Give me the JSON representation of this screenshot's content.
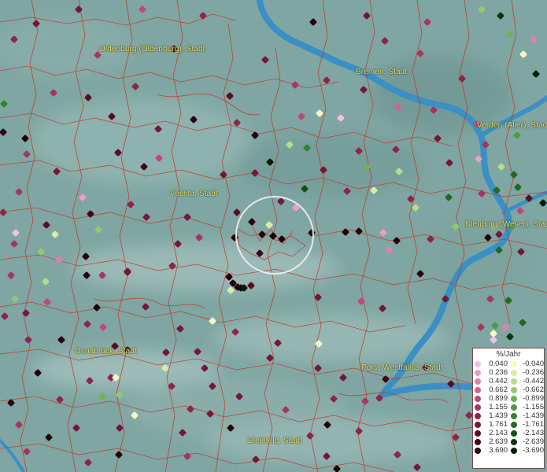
{
  "map": {
    "unit": "%/Jahr",
    "colors": {
      "background": "#7fa6a2",
      "river": "#3a8fc4",
      "boundary": "#c0392b",
      "label": "#e5e06a",
      "focus_ring": "#f2f2f2"
    },
    "places": [
      {
        "id": "oldenburg",
        "name": "Oldenburg (Oldenburg), Stadt"
      },
      {
        "id": "bremen",
        "name": "Bremen, Stadt"
      },
      {
        "id": "verden",
        "name": "Verden (Aller), Stadt"
      },
      {
        "id": "vechta",
        "name": "Vechta, Stadt"
      },
      {
        "id": "nienburg",
        "name": "Nienburg (Weser), Stadt"
      },
      {
        "id": "osnabrueck",
        "name": "Osnabrück, Stadt"
      },
      {
        "id": "porta",
        "name": "Porta Westfalica, Stadt"
      },
      {
        "id": "bielefeld",
        "name": "Bielefeld, Stadt"
      }
    ],
    "legend": {
      "title": "%/Jahr",
      "positive": [
        {
          "label": "0.040",
          "color": "#f6bde8"
        },
        {
          "label": "0.236",
          "color": "#ec9dcc"
        },
        {
          "label": "0.442",
          "color": "#df7fb0"
        },
        {
          "label": "0.662",
          "color": "#cf6394"
        },
        {
          "label": "0.899",
          "color": "#bb4a7a"
        },
        {
          "label": "1.155",
          "color": "#a63562"
        },
        {
          "label": "1.439",
          "color": "#8e244c"
        },
        {
          "label": "1.761",
          "color": "#761638"
        },
        {
          "label": "2.143",
          "color": "#5c0b26"
        },
        {
          "label": "2.639",
          "color": "#420417"
        },
        {
          "label": "3.690",
          "color": "#26000a"
        }
      ],
      "negative": [
        {
          "label": "-0.040",
          "color": "#f7f8c8"
        },
        {
          "label": "-0.236",
          "color": "#d7eeaa"
        },
        {
          "label": "-0.442",
          "color": "#b5de8c"
        },
        {
          "label": "-0.662",
          "color": "#92c96e"
        },
        {
          "label": "-0.899",
          "color": "#6fb355"
        },
        {
          "label": "-1.155",
          "color": "#4f9a41"
        },
        {
          "label": "-1.439",
          "color": "#378230"
        },
        {
          "label": "-1.761",
          "color": "#236823"
        },
        {
          "label": "-2.143",
          "color": "#144f16"
        },
        {
          "label": "-2.639",
          "color": "#08360c"
        },
        {
          "label": "-3.690",
          "color": "#011d04"
        }
      ]
    }
  }
}
